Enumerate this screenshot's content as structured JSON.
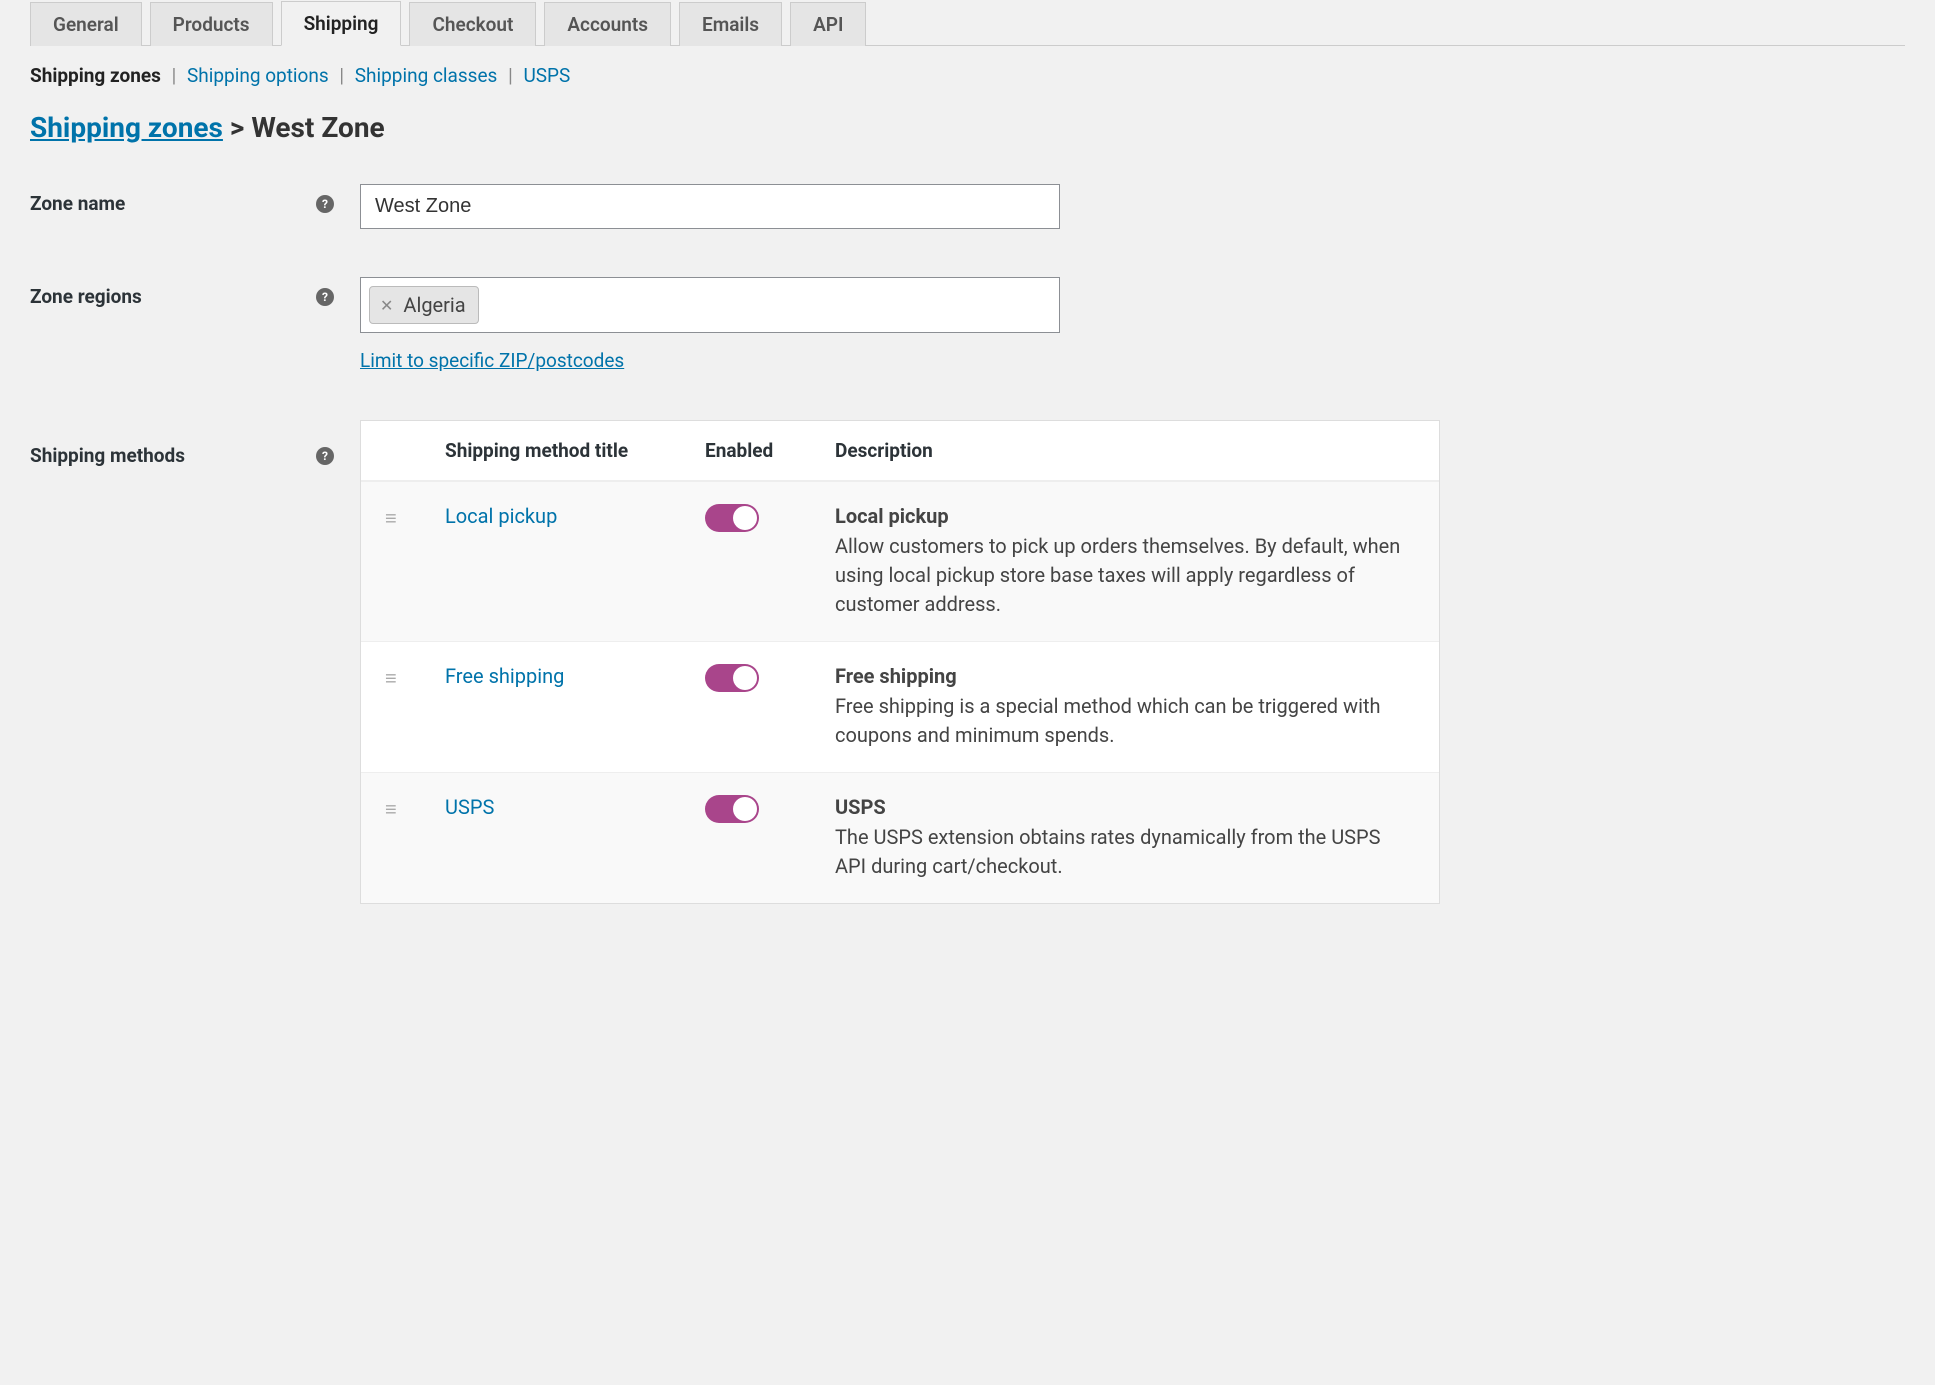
{
  "tabs": [
    {
      "label": "General",
      "active": false
    },
    {
      "label": "Products",
      "active": false
    },
    {
      "label": "Shipping",
      "active": true
    },
    {
      "label": "Checkout",
      "active": false
    },
    {
      "label": "Accounts",
      "active": false
    },
    {
      "label": "Emails",
      "active": false
    },
    {
      "label": "API",
      "active": false
    }
  ],
  "subnav": {
    "items": [
      {
        "label": "Shipping zones",
        "active": true
      },
      {
        "label": "Shipping options",
        "active": false
      },
      {
        "label": "Shipping classes",
        "active": false
      },
      {
        "label": "USPS",
        "active": false
      }
    ]
  },
  "breadcrumb": {
    "parent": "Shipping zones",
    "separator": ">",
    "current": "West Zone"
  },
  "form": {
    "zone_name": {
      "label": "Zone name",
      "value": "West Zone"
    },
    "zone_regions": {
      "label": "Zone regions",
      "tags": [
        {
          "label": "Algeria"
        }
      ],
      "limit_link": "Limit to specific ZIP/postcodes"
    },
    "shipping_methods": {
      "label": "Shipping methods",
      "columns": {
        "title": "Shipping method title",
        "enabled": "Enabled",
        "description": "Description"
      },
      "rows": [
        {
          "title": "Local pickup",
          "enabled": true,
          "desc_title": "Local pickup",
          "desc_text": "Allow customers to pick up orders themselves. By default, when using local pickup store base taxes will apply regardless of customer address."
        },
        {
          "title": "Free shipping",
          "enabled": true,
          "desc_title": "Free shipping",
          "desc_text": "Free shipping is a special method which can be triggered with coupons and minimum spends."
        },
        {
          "title": "USPS",
          "enabled": true,
          "desc_title": "USPS",
          "desc_text": "The USPS extension obtains rates dynamically from the USPS API during cart/checkout."
        }
      ]
    }
  }
}
